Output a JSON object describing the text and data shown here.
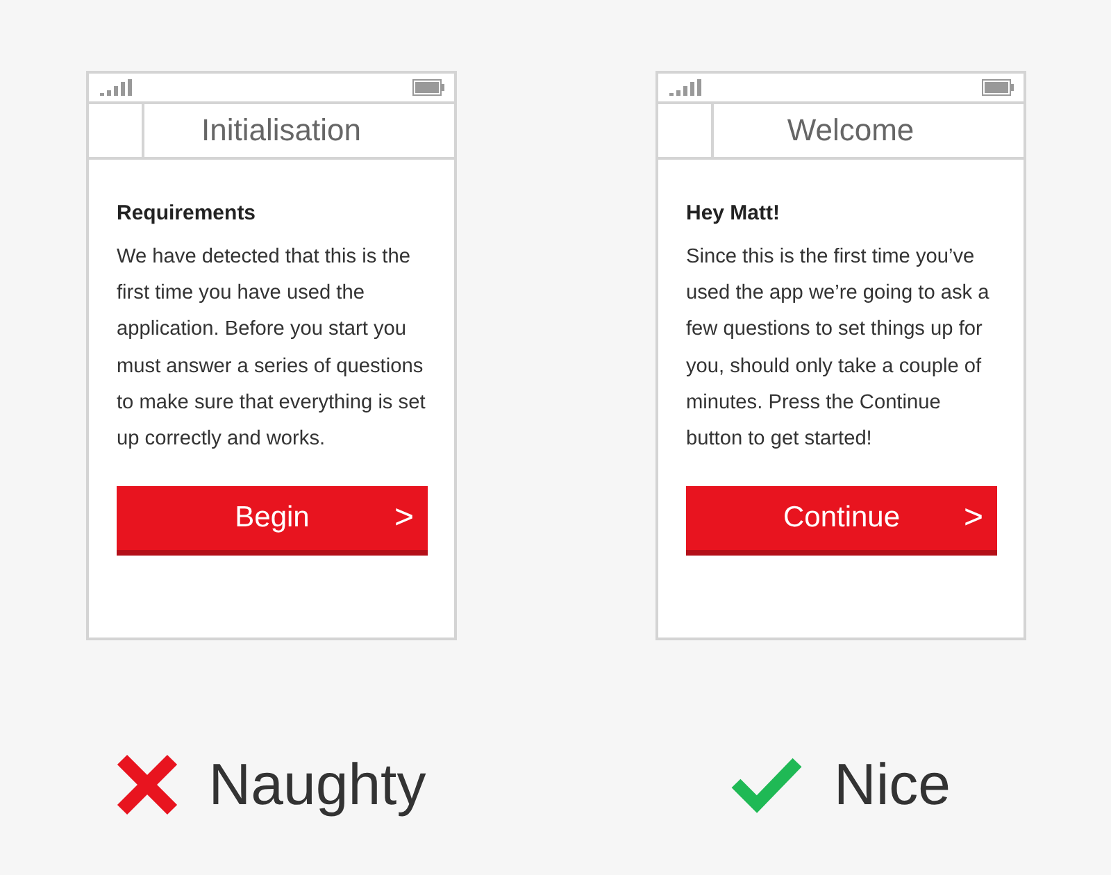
{
  "panels": [
    {
      "title": "Initialisation",
      "heading": "Requirements",
      "body": "We have detected that this is the first time you have used the application. Before you start you must answer a series of questions to make sure that everything is set up correctly and works.",
      "button": {
        "label": "Begin",
        "arrow": ">"
      },
      "verdict": {
        "kind": "cross",
        "label": "Naughty"
      }
    },
    {
      "title": "Welcome",
      "heading": "Hey Matt!",
      "body": "Since this is the first time you’ve used the app we’re going to ask a few questions to set things up for you, should only take a couple of minutes. Press the Continue button to get started!",
      "button": {
        "label": "Continue",
        "arrow": ">"
      },
      "verdict": {
        "kind": "check",
        "label": "Nice"
      }
    }
  ]
}
